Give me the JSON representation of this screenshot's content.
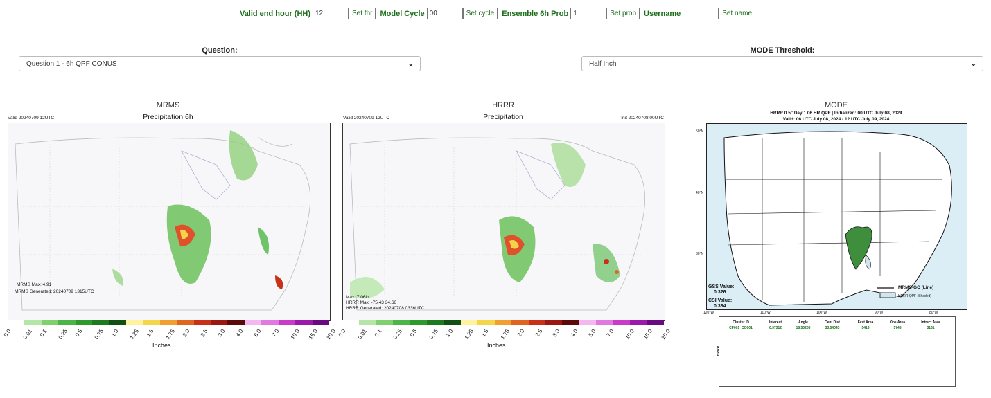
{
  "controls": {
    "end_hour_label": "Valid end hour (HH)",
    "end_hour_value": "12",
    "end_hour_btn": "Set fhr",
    "cycle_label": "Model Cycle",
    "cycle_value": "00",
    "cycle_btn": "Set cycle",
    "prob_label": "Ensemble 6h Prob",
    "prob_value": "1",
    "prob_btn": "Set prob",
    "user_label": "Username",
    "user_value": "",
    "user_btn": "Set name"
  },
  "question": {
    "label": "Question:",
    "selected": "Question 1 - 6h QPF CONUS"
  },
  "threshold": {
    "label": "MODE Threshold:",
    "selected": "Half Inch"
  },
  "mrms": {
    "panel_title": "MRMS",
    "valid": "Valid 20240709 12UTC",
    "title": "Precipitation 6h",
    "max": "MRMS Max: 4.91",
    "generated": "MRMS Generated: 20240709 1315UTC",
    "units": "Inches"
  },
  "hrrr": {
    "panel_title": "HRRR",
    "valid": "Valid 20240709 12UTC",
    "title": "Precipitation",
    "init": "Init 20240708 00UTC",
    "max": "Max: 7.06in",
    "hrrr_max": "HRRR Max: -75.43 34.66",
    "generated": "HRRR Generated: 20240708 0336UTC",
    "units": "Inches"
  },
  "colorbar": {
    "ticks": [
      "0.0",
      "0.01",
      "0.1",
      "0.25",
      "0.5",
      "0.75",
      "1.0",
      "1.25",
      "1.5",
      "1.75",
      "2.0",
      "2.5",
      "3.0",
      "4.0",
      "5.0",
      "7.0",
      "10.0",
      "15.0",
      "20.0"
    ],
    "colors": [
      "#ffffff",
      "#b5e6a8",
      "#7fd16e",
      "#4cb545",
      "#2e9a2e",
      "#1f7a1f",
      "#124f12",
      "#fff3a0",
      "#f5d54a",
      "#f0a030",
      "#e06520",
      "#c83018",
      "#9a1810",
      "#5c0a08",
      "#f4b8f0",
      "#e07ae0",
      "#c83cc8",
      "#9a1aaa",
      "#6a0a80"
    ]
  },
  "mode": {
    "panel_title": "MODE",
    "title1": "HRRR 0.5\" Day 1 06 HR QPF | Initialized: 00 UTC July 08, 2024",
    "title2": "Valid: 06 UTC July 08, 2024 - 12 UTC July 09, 2024",
    "gss_label": "GSS Value:",
    "gss_value": "0.326",
    "csi_label": "CSI Value:",
    "csi_value": "0.334",
    "legend_line": "MRMS-GC (Line)",
    "legend_shaded": "HRRR QPF (Shaded)",
    "lat_labels": [
      "50°N",
      "40°N",
      "30°N"
    ],
    "lon_labels": [
      "120°W",
      "110°W",
      "100°W",
      "90°W",
      "80°W"
    ]
  },
  "table": {
    "side_label": "HRRR",
    "headers": [
      "Cluster ID",
      "Interest",
      "Angle",
      "Cent Dist",
      "Fcst Area",
      "Obs Area",
      "Intrsct Area"
    ],
    "values": [
      "CF001_CO001",
      "0.97312",
      "18.50208",
      "33.54043",
      "5413",
      "5745",
      "3161"
    ]
  }
}
